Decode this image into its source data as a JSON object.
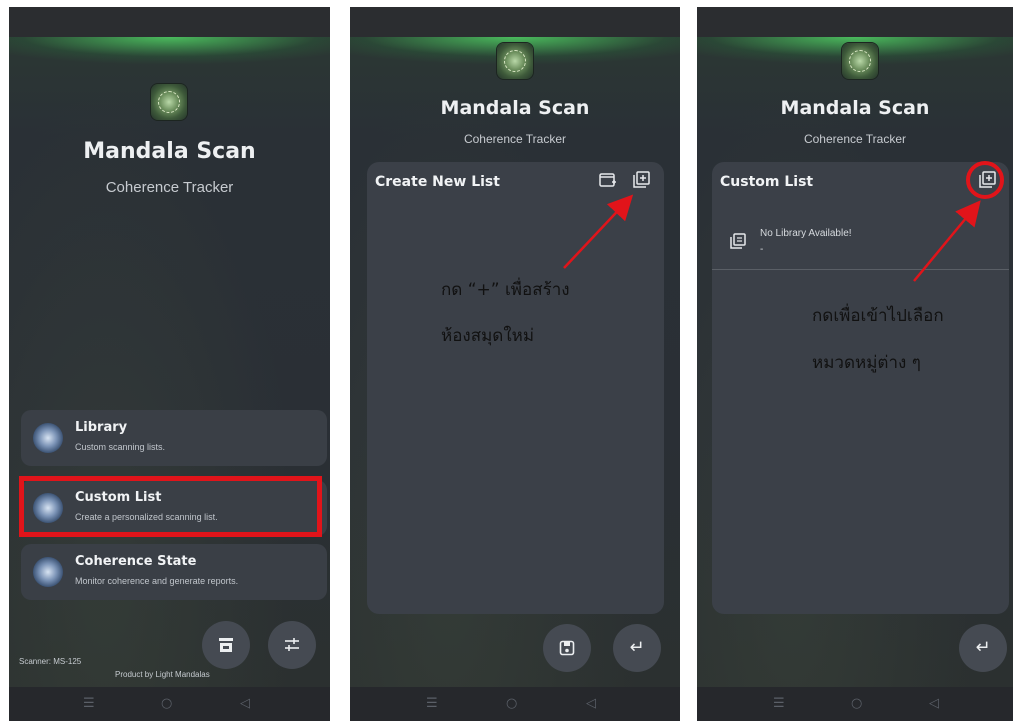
{
  "app": {
    "title": "Mandala Scan",
    "subtitle": "Coherence Tracker"
  },
  "screen1": {
    "menu": [
      {
        "title": "Library",
        "description": "Custom scanning lists."
      },
      {
        "title": "Custom List",
        "description": "Create a personalized scanning list."
      },
      {
        "title": "Coherence State",
        "description": "Monitor coherence and generate reports."
      }
    ],
    "scanner_label": "Scanner:  MS-125",
    "footer": "Product by Light Mandalas",
    "fab_icons": [
      "store-icon",
      "sliders-icon"
    ]
  },
  "screen2": {
    "panel_title": "Create New List",
    "annotation_line1": "กด “+” เพื่อสร้าง",
    "annotation_line2": "ห้องสมุดใหม่"
  },
  "screen3": {
    "panel_title": "Custom List",
    "empty_title": "No Library Available!",
    "empty_sub": "-",
    "annotation_line1": "กดเพื่อเข้าไปเลือก",
    "annotation_line2": "หมวดหมู่ต่าง ๆ"
  },
  "colors": {
    "highlight": "#e1141a",
    "arrow": "#e1141a",
    "card": "#3a3f46"
  }
}
